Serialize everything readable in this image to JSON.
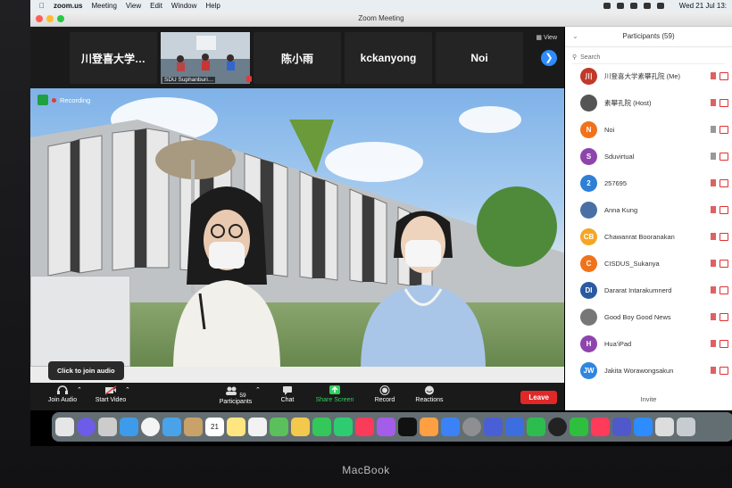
{
  "menubar": {
    "items": [
      "zoom.us",
      "Meeting",
      "View",
      "Edit",
      "Window",
      "Help"
    ],
    "clock": "Wed 21 Jul  13:"
  },
  "window": {
    "title": "Zoom Meeting"
  },
  "gallery": {
    "tiles": [
      {
        "name": "川登喜大学…"
      },
      {
        "name": "",
        "label": "SDU Suphanburi…"
      },
      {
        "name": "陈小雨"
      },
      {
        "name": "kckanyong"
      },
      {
        "name": "Noi"
      }
    ],
    "view_label": "View"
  },
  "main_video": {
    "recording_label": "Recording",
    "tooltip": "Click to join audio"
  },
  "toolbar": {
    "join_audio": "Join Audio",
    "start_video": "Start Video",
    "participants": "Participants",
    "participant_count": "59",
    "chat": "Chat",
    "share_screen": "Share Screen",
    "record": "Record",
    "reactions": "Reactions",
    "leave": "Leave"
  },
  "participants_panel": {
    "title": "Participants (59)",
    "search_placeholder": "Search",
    "invite": "Invite",
    "list": [
      {
        "initials": "川",
        "name": "川登喜大学素攀孔院 (Me)",
        "color": "#c0392b"
      },
      {
        "initials": "",
        "name": "素攀孔院 (Host)",
        "color": "#555555"
      },
      {
        "initials": "N",
        "name": "Noi",
        "color": "#f0731b"
      },
      {
        "initials": "S",
        "name": "Sduvirtual",
        "color": "#8e44ad"
      },
      {
        "initials": "2",
        "name": "257695",
        "color": "#2e7fd6"
      },
      {
        "initials": "",
        "name": "Anna Kung",
        "color": "#4a6fa5"
      },
      {
        "initials": "CB",
        "name": "Chawanrat Booranakan",
        "color": "#f5a623"
      },
      {
        "initials": "C",
        "name": "CISDUS_Sukanya",
        "color": "#f0731b"
      },
      {
        "initials": "DI",
        "name": "Dararat Intarakumnerd",
        "color": "#2c5aa0"
      },
      {
        "initials": "",
        "name": "Good Boy Good News",
        "color": "#777777"
      },
      {
        "initials": "H",
        "name": "Hua'iPad",
        "color": "#8e44ad"
      },
      {
        "initials": "JW",
        "name": "Jakita Worawongsakun",
        "color": "#2e86de"
      }
    ]
  },
  "dock": {
    "calendar_day": "21"
  },
  "laptop": {
    "brand": "MacBook"
  }
}
